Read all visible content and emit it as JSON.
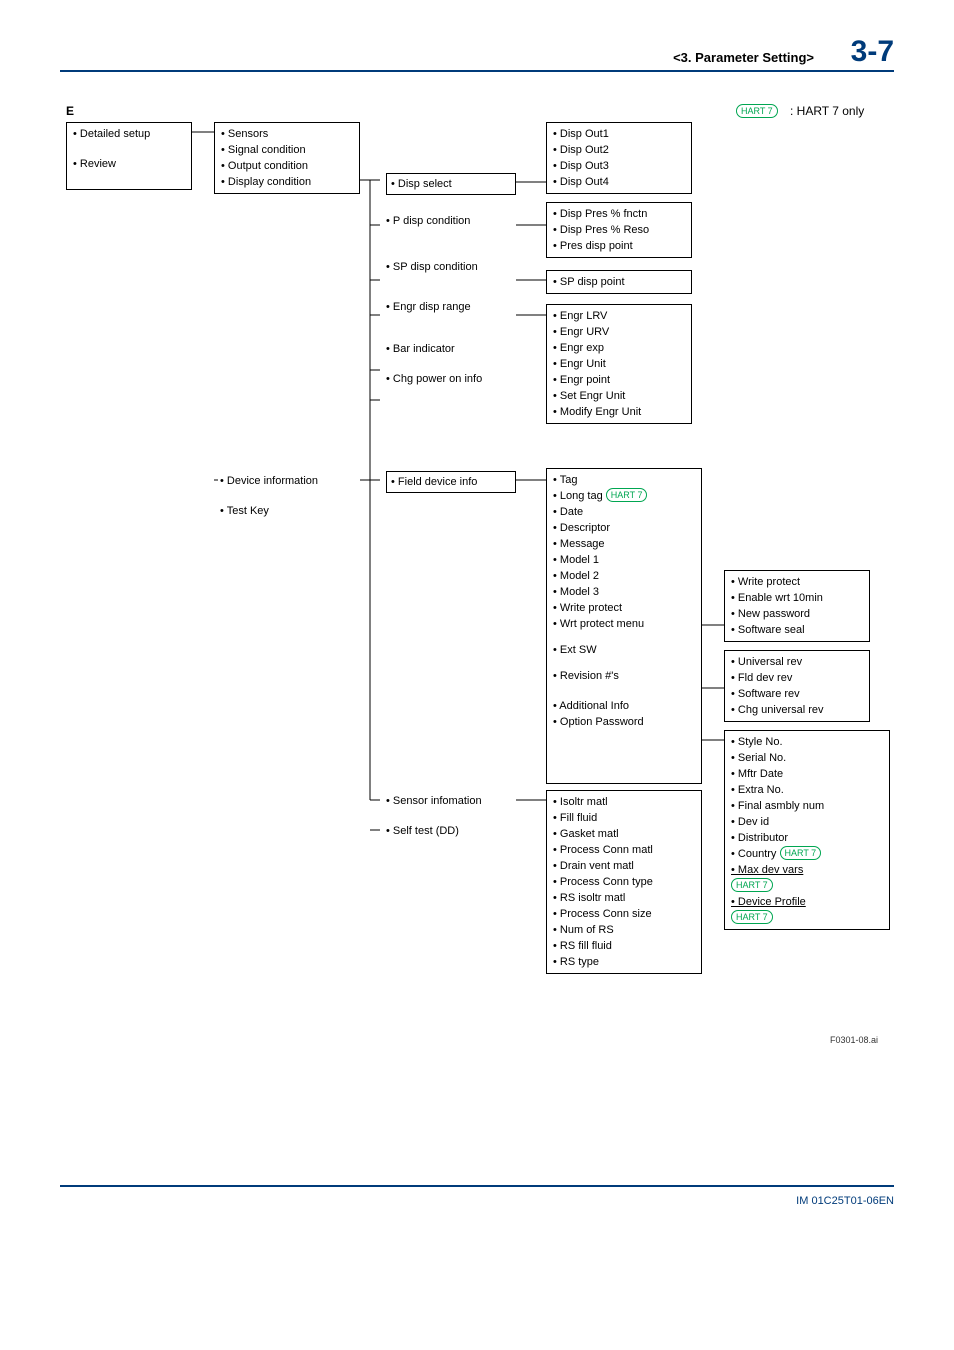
{
  "header": {
    "section": "<3.  Parameter Setting>",
    "pagenum": "3-7",
    "e": "E"
  },
  "legend": {
    "badge": "HART 7",
    "text": ": HART 7 only"
  },
  "col1": {
    "items": [
      "• Detailed setup",
      "• Review"
    ]
  },
  "col2a": {
    "items": [
      "• Sensors",
      "• Signal condition",
      "• Output condition",
      "• Display condition"
    ]
  },
  "col2b": {
    "items": [
      "• Device information",
      "• Test Key"
    ]
  },
  "col3a": {
    "items": [
      "• Disp select",
      "• P disp condition",
      "• SP disp condition",
      "• Engr disp range",
      "• Bar indicator",
      "• Chg power on info"
    ]
  },
  "col3b": {
    "items": [
      "• Field device info",
      "• Sensor infomation",
      "• Self test (DD)"
    ]
  },
  "col4a": {
    "items": [
      "• Disp Out1",
      "• Disp Out2",
      "• Disp Out3",
      "• Disp Out4"
    ]
  },
  "col4b": {
    "items": [
      "• Disp Pres % fnctn",
      "• Disp Pres % Reso",
      "• Pres disp point"
    ]
  },
  "col4c": {
    "items": [
      "• SP disp point"
    ]
  },
  "col4d": {
    "items": [
      "• Engr LRV",
      "• Engr URV",
      "• Engr exp",
      "• Engr Unit",
      "• Engr point",
      "• Set Engr Unit",
      "• Modify Engr Unit"
    ]
  },
  "col4e": {
    "items": [
      "• Tag",
      "• Long tag",
      "• Date",
      "• Descriptor",
      "• Message",
      "• Model 1",
      "• Model 2",
      "• Model 3",
      "• Write protect",
      "• Wrt protect menu",
      "• Ext SW",
      "• Revision #'s",
      "• Additional Info",
      "• Option Password"
    ]
  },
  "col4f": {
    "items": [
      "• Isoltr matl",
      "• Fill fluid",
      "• Gasket matl",
      "• Process Conn matl",
      "• Drain vent matl",
      "• Process Conn type",
      "• RS isoltr matl",
      "• Process Conn size",
      "• Num of RS",
      "• RS fill fluid",
      "• RS type"
    ]
  },
  "col5a": {
    "items": [
      "• Write protect",
      "• Enable wrt 10min",
      "• New password",
      "• Software seal"
    ]
  },
  "col5b": {
    "items": [
      "• Universal rev",
      "• Fld dev rev",
      "• Software rev",
      "• Chg universal rev"
    ]
  },
  "col5c": {
    "items": [
      "• Style No.",
      "• Serial No.",
      "• Mftr Date",
      "• Extra No.",
      "• Final asmbly num",
      "• Dev id",
      "• Distributor",
      "• Country",
      "• Max dev vars",
      "• Device Profile"
    ]
  },
  "hart7": "HART 7",
  "figid": "F0301-08.ai",
  "footer": "IM 01C25T01-06EN"
}
